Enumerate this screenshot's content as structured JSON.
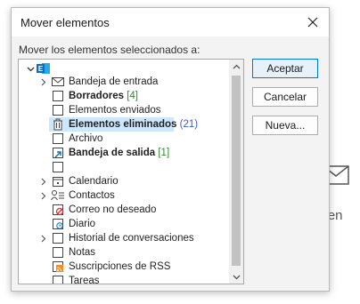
{
  "dialog": {
    "title": "Mover elementos",
    "prompt": "Mover los elementos seleccionados a:"
  },
  "buttons": {
    "accept": "Aceptar",
    "cancel": "Cancelar",
    "new": "Nueva..."
  },
  "background": {
    "peek_text": "emen"
  },
  "tree": {
    "items": [
      {
        "label": "",
        "icon": "outlook-account-icon",
        "expander": "expanded"
      },
      {
        "label": "Bandeja de entrada",
        "icon": "inbox-icon",
        "expander": "collapsed"
      },
      {
        "label": "Borradores",
        "count": "[4]",
        "icon": "drafts-icon"
      },
      {
        "label": "Elementos enviados",
        "icon": "folder-icon"
      },
      {
        "label": "Elementos eliminados",
        "count": "(21)",
        "icon": "deleted-items-icon",
        "selected": true
      },
      {
        "label": "Archivo",
        "icon": "folder-icon"
      },
      {
        "label": "Bandeja de salida",
        "count": "[1]",
        "icon": "outbox-icon"
      },
      {
        "label": "",
        "icon": "folder-icon"
      },
      {
        "label": "Calendario",
        "icon": "calendar-icon",
        "expander": "collapsed"
      },
      {
        "label": "Contactos",
        "icon": "contacts-icon",
        "expander": "collapsed"
      },
      {
        "label": "Correo no deseado",
        "icon": "junk-mail-icon"
      },
      {
        "label": "Diario",
        "icon": "journal-icon"
      },
      {
        "label": "Historial de conversaciones",
        "icon": "folder-icon",
        "expander": "collapsed"
      },
      {
        "label": "Notas",
        "icon": "notes-icon"
      },
      {
        "label": "Suscripciones de RSS",
        "icon": "rss-icon"
      },
      {
        "label": "Tareas",
        "icon": "tasks-icon"
      }
    ]
  }
}
